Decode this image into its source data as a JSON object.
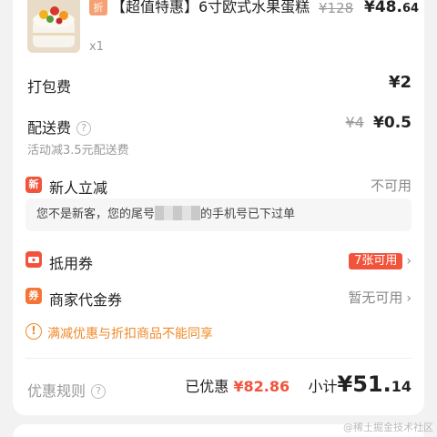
{
  "product": {
    "tag": "折",
    "title": "【超值特惠】6寸欧式水果蛋糕",
    "price_old": "¥128",
    "price_now_main": "¥48.",
    "price_now_dec": "64",
    "qty": "x1"
  },
  "packing": {
    "label": "打包费",
    "value": "¥2"
  },
  "delivery": {
    "label": "配送费",
    "help": "?",
    "price_old": "¥4",
    "price_now": "¥0.5",
    "note": "活动减3.5元配送费"
  },
  "new_user": {
    "icon": "新",
    "label": "新人立减",
    "status": "不可用",
    "info_before": "您不是新客，您的尾号",
    "info_after": "的手机号已下过单"
  },
  "coupon": {
    "icon": "coupon-icon",
    "label": "抵用券",
    "badge": "7张可用",
    "chevron": "›"
  },
  "merchant_voucher": {
    "icon": "券",
    "label": "商家代金券",
    "status": "暂无可用",
    "chevron": "›"
  },
  "warning": {
    "icon": "!",
    "text": "满减优惠与折扣商品不能同享"
  },
  "footer": {
    "rules_label": "优惠规则",
    "rules_help": "?",
    "saved_label": "已优惠",
    "saved_amount": "¥82.86",
    "subtotal_label": "小计",
    "subtotal_main": "¥51.",
    "subtotal_dec": "14"
  },
  "watermark": "@稀土掘金技术社区",
  "colors": {
    "accent_red": "#f2533b",
    "warning_orange": "#f08a2a"
  }
}
